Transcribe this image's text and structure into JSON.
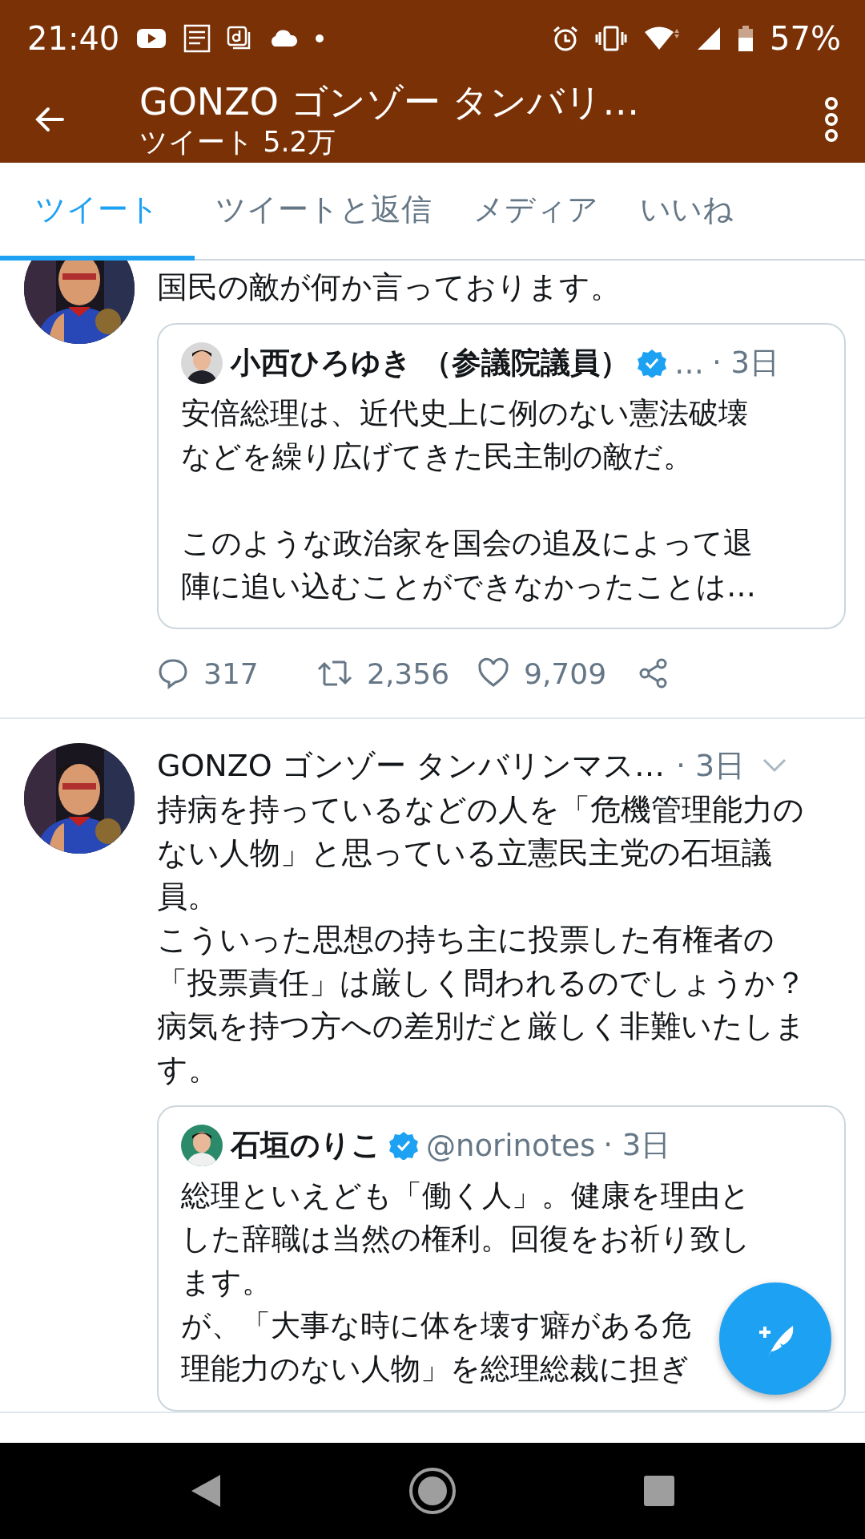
{
  "status_bar": {
    "time": "21:40",
    "battery": "57%"
  },
  "header": {
    "title": "GONZO ゴンゾー タンバリ…",
    "subtitle": "ツイート 5.2万"
  },
  "tabs": [
    {
      "label": "ツイート",
      "selected": true
    },
    {
      "label": "ツイートと返信",
      "selected": false
    },
    {
      "label": "メディア",
      "selected": false
    },
    {
      "label": "いいね",
      "selected": false
    }
  ],
  "tweets": [
    {
      "lines": [
        "国民の敵が何か言っております。"
      ],
      "quote": {
        "name": "小西ひろゆき （参議院議員）",
        "verified": true,
        "handle": "…",
        "time": "· 3日",
        "paragraphs": [
          [
            "安倍総理は、近代史上に例のない憲法破壊",
            "などを繰り広げてきた民主制の敵だ。"
          ],
          [
            "このような政治家を国会の追及によって退",
            "陣に追い込むことができなかったことは…"
          ]
        ]
      },
      "actions": {
        "replies": "317",
        "retweets": "2,356",
        "likes": "9,709"
      }
    },
    {
      "name": "GONZO ゴンゾー タンバリンマス…",
      "time": "· 3日",
      "lines": [
        "持病を持っているなどの人を「危機管理能力の",
        "ない人物」と思っている立憲民主党の石垣議",
        "員。",
        "こういった思想の持ち主に投票した有権者の",
        "「投票責任」は厳しく問われるのでしょうか？",
        "病気を持つ方への差別だと厳しく非難いたしま",
        "す。"
      ],
      "quote": {
        "name": "石垣のりこ",
        "verified": true,
        "handle": "@norinotes",
        "time": "· 3日",
        "paragraphs": [
          [
            "総理といえども「働く人」。健康を理由と",
            "した辞職は当然の権利。回復をお祈り致し",
            "ます。",
            "が、「大事な時に体を壊す癖がある危",
            "理能力のない人物」を総理総裁に担ぎ"
          ]
        ]
      }
    }
  ]
}
